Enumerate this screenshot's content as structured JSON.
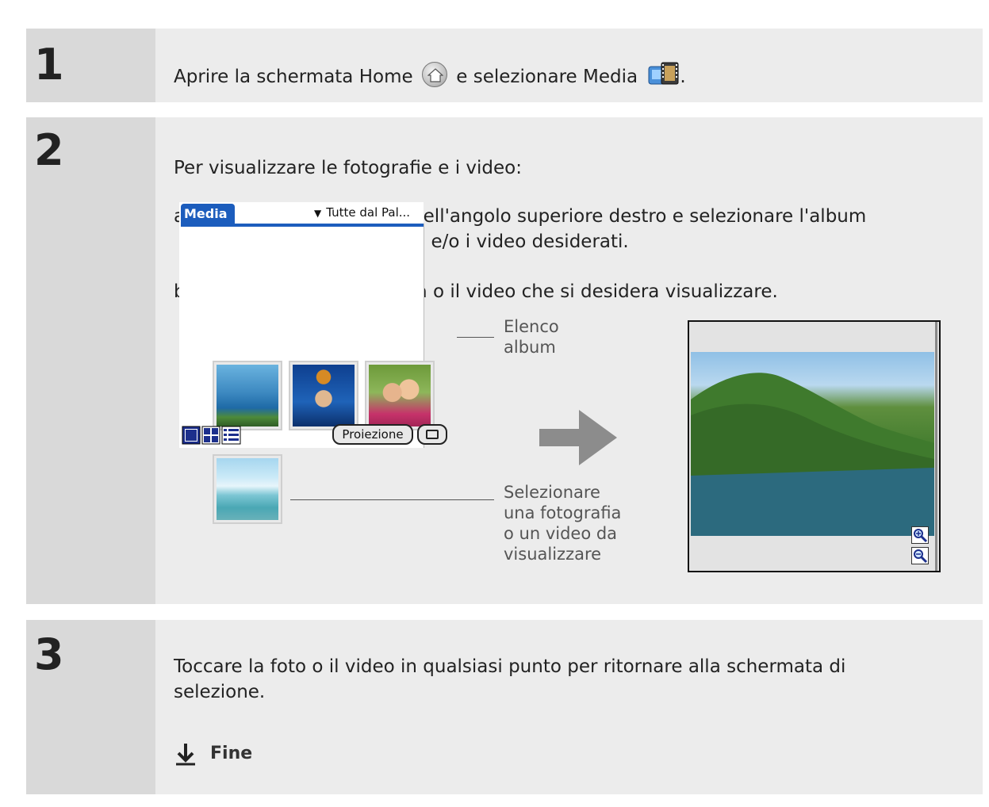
{
  "steps": [
    {
      "number": "1",
      "text_before_home": "Aprire la schermata Home",
      "text_between": "e selezionare Media",
      "text_after": "."
    },
    {
      "number": "2",
      "intro": "Per visualizzare le fotografie e i video:",
      "item_a_marker": "a.",
      "item_a_line1": "Toccare l'elenco posto nell'angolo superiore destro e selezionare l'album",
      "item_a_line2": "contenente le fotografie e/o i video desiderati.",
      "item_b_marker": "b.",
      "item_b_text": "Selezionare la fotografia o il video che si desidera visualizzare."
    },
    {
      "number": "3",
      "line1": "Toccare la foto o il video in qualsiasi punto per ritornare alla schermata di",
      "line2": "selezione.",
      "done_label": "Fine"
    }
  ],
  "palm": {
    "tab_label": "Media",
    "dropdown_label": "Tutte dal Pal...",
    "slideshow_button": "Proiezione"
  },
  "callouts": {
    "album_list_line1": "Elenco",
    "album_list_line2": "album",
    "select_line1": "Selezionare",
    "select_line2": "una fotografia",
    "select_line3": "o un video da",
    "select_line4": "visualizzare"
  },
  "colors": {
    "step_number_bg": "#d9d9d9",
    "step_body_bg": "#ececec",
    "palm_accent": "#1c5dbd"
  },
  "icons": [
    "home-icon",
    "media-app-icon",
    "right-arrow-icon",
    "zoom-in-icon",
    "zoom-out-icon",
    "camera-icon",
    "down-arrow-icon"
  ]
}
